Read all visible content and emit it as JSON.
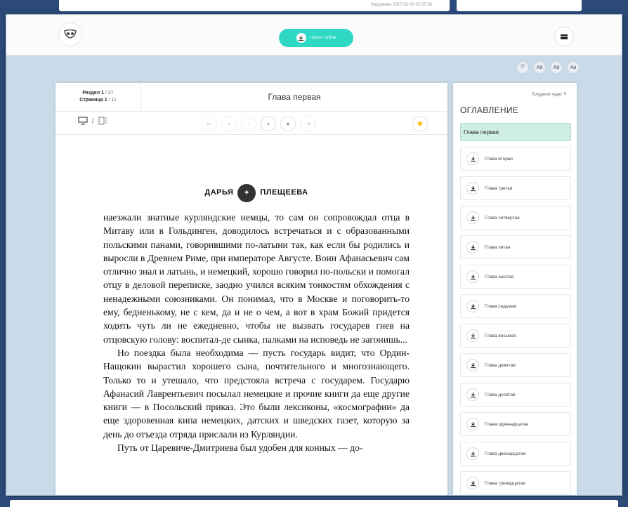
{
  "top": {
    "loaded_text": "Загружено 2017-02-02 02:57:38"
  },
  "appbar": {
    "search_label": "поиск / online"
  },
  "font_tools": [
    "⤧",
    "Aā",
    "Aā",
    "Aa"
  ],
  "reader": {
    "section_label": "Раздел",
    "section_value": "1",
    "section_total": "/ 27",
    "page_label": "Страница",
    "page_value": "1",
    "page_total": "/ 11",
    "chapter_title": "Глава первая",
    "view_separator": "/",
    "nav": [
      "⇤",
      "«",
      "‹",
      "›",
      "»",
      "⇥"
    ],
    "page_header_left": "ДАРЬЯ",
    "page_header_right": "ПЛЕЩЕЕВА",
    "paragraphs": [
      "наезжали знатные курляндские немцы, то сам он сопровождал отца в Митаву или в Гольдинген, доводилось встречаться и с образованными польскими панами, говорившими по-латыни так, как если бы родились и выросли в Древнем Риме, при императоре Августе. Воин Афанасьевич сам отлично знал и латынь, и немецкий, хорошо говорил по-польски и помогал отцу в деловой переписке, заодно учился всяким тонкостям обхождения с ненадежными союзниками. Он понимал, что в Москве и поговорить-то ему, бедненькому, не с кем, да и не о чем, а вот в храм Божий придется ходить чуть ли не ежедневно, чтобы не вызвать государев гнев на отцовскую голову: воспитал-де сынка, палками на исповедь не загонишь...",
      "Но поездка была необходима — пусть государь видит, что Ордин-Нащокин вырастил хорошего сына, почтительного и многознающего. Только то и утешало, что предстояла встреча с государем. Государю Афанасий Лаврентьевич посылал немецкие и прочие книги да еще другие книги — в Посольский приказ. Это были лексиконы, «космографии» да еще здоровенная кипа немецких, датских и шведских газет, которую за день до отъезда отряда прислали из Курляндии.",
      "Путь от Царевиче-Дмитриева был удобен для конных — до-"
    ]
  },
  "toc": {
    "link_label": "Блудное чадо",
    "title": "ОГЛАВЛЕНИЕ",
    "items": [
      "Глава первая",
      "Глава вторая",
      "Глава третья",
      "Глава четвертая",
      "Глава пятая",
      "Глава шестая",
      "Глава седьмая",
      "Глава восьмая",
      "Глава девятая",
      "Глава десятая",
      "Глава одиннадцатая",
      "Глава двенадцатая",
      "Глава тринадцатая"
    ]
  },
  "colors": {
    "accent": "#2ed8c3",
    "toc_active": "#cfeee5",
    "star": "#f5b800",
    "background": "#c9dbe8",
    "frame": "#2c4a78"
  }
}
